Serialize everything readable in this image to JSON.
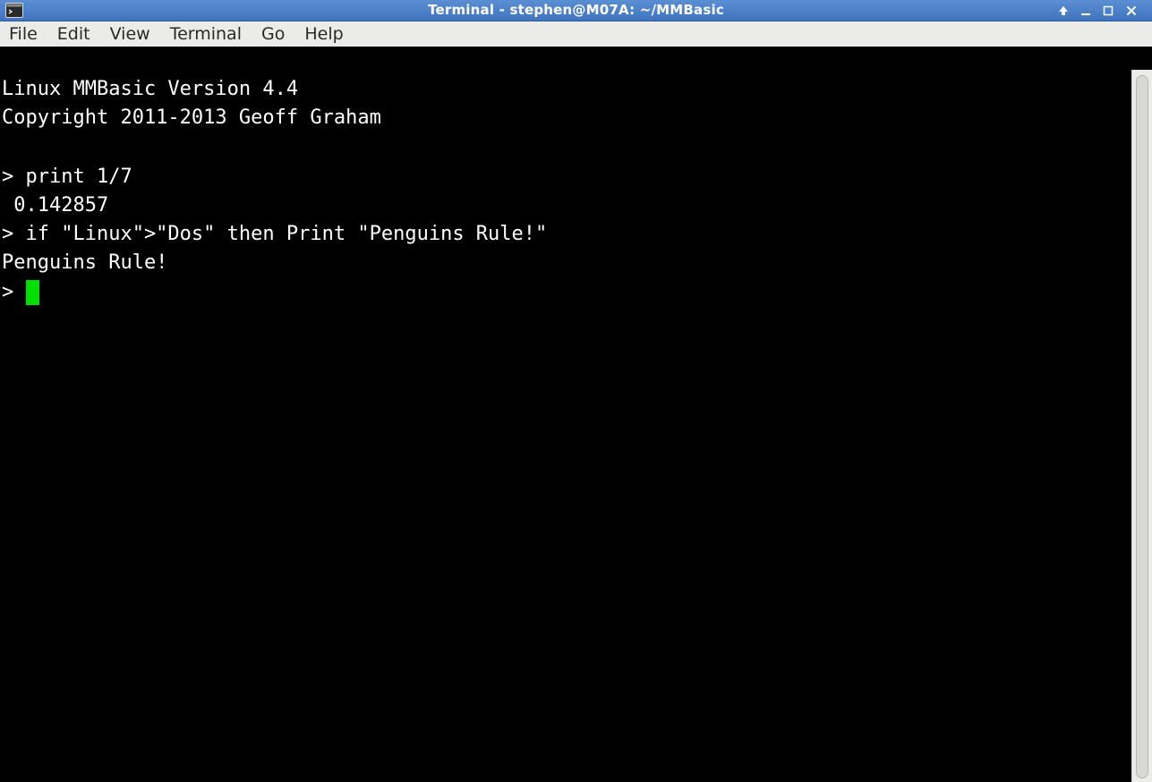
{
  "window": {
    "title": "Terminal - stephen@M07A: ~/MMBasic",
    "icons": {
      "app": "terminal-icon",
      "shade": "arrow-up-icon",
      "minimize": "minimize-icon",
      "maximize": "maximize-icon",
      "close": "close-icon"
    }
  },
  "menu": {
    "items": [
      "File",
      "Edit",
      "View",
      "Terminal",
      "Go",
      "Help"
    ]
  },
  "terminal": {
    "lines": [
      "Linux MMBasic Version 4.4",
      "Copyright 2011-2013 Geoff Graham",
      "",
      "> print 1/7",
      " 0.142857",
      "> if \"Linux\">\"Dos\" then Print \"Penguins Rule!\"",
      "Penguins Rule!"
    ],
    "prompt": "> ",
    "cursor_color": "#00e000",
    "background": "#000000",
    "foreground": "#ffffff"
  }
}
